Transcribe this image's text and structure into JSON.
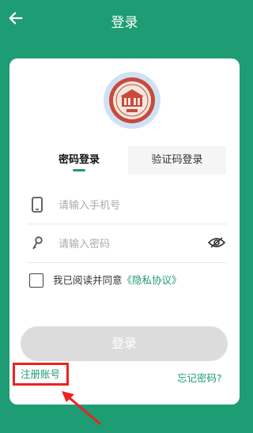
{
  "header": {
    "title": "登录",
    "back_icon": "arrow-left-icon"
  },
  "logo": {
    "name": "school-emblem"
  },
  "tabs": [
    {
      "label": "密码登录",
      "active": true
    },
    {
      "label": "验证码登录",
      "active": false
    }
  ],
  "form": {
    "phone_placeholder": "请输入手机号",
    "password_placeholder": "请输入密码",
    "phone_icon": "phone-icon",
    "password_icon": "key-icon",
    "visibility_icon": "eye-off-icon"
  },
  "agreement": {
    "text": "我已阅读并同意",
    "link": "《隐私协议》",
    "checked": false
  },
  "buttons": {
    "login": "登录",
    "register": "注册账号",
    "forgot": "忘记密码?"
  },
  "colors": {
    "primary": "#1e9c73",
    "highlight": "#ee2222",
    "button_disabled": "#dcdcdc"
  }
}
